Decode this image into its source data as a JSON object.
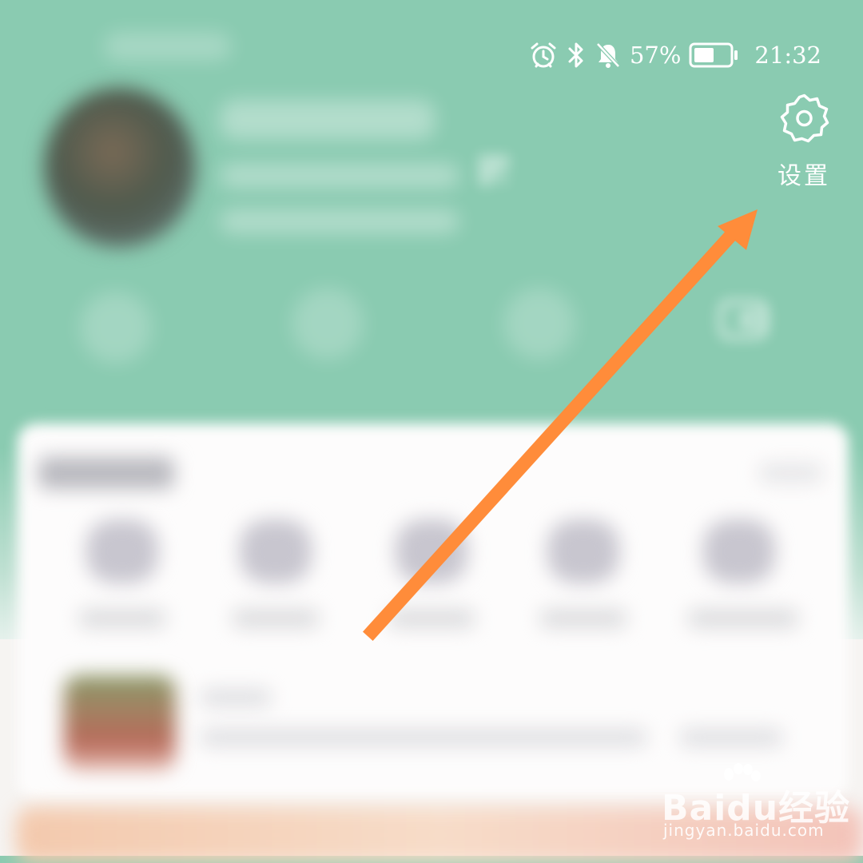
{
  "status_bar": {
    "battery_percent": "57%",
    "time": "21:32",
    "icons": [
      "alarm-icon",
      "bluetooth-icon",
      "bell-muted-icon",
      "battery-icon"
    ],
    "battery_level": 0.57
  },
  "settings": {
    "label": "设置",
    "icon": "gear-icon"
  },
  "annotation": {
    "arrow_color": "#ff8c3a"
  },
  "watermark": {
    "brand": "Baidu",
    "brand_suffix": "经验",
    "url": "jingyan.baidu.com"
  },
  "colors": {
    "header": "#8acbb1",
    "card": "#fdfcfc",
    "accent": "#ff8c3a"
  }
}
